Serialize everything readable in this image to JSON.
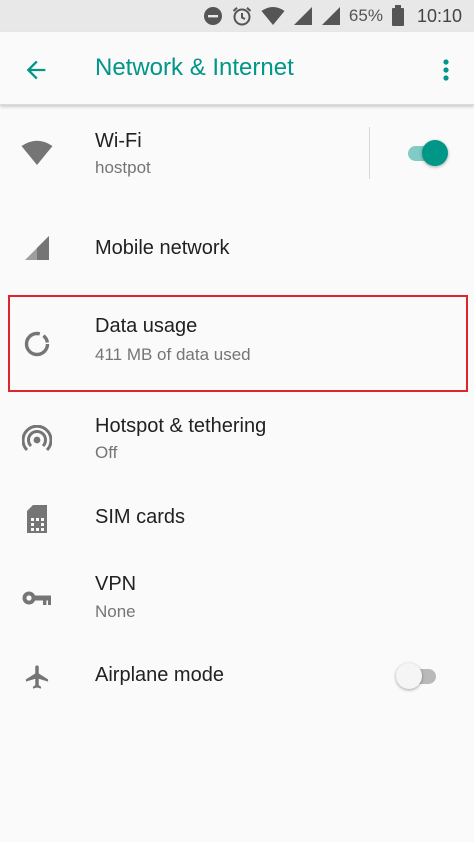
{
  "status_bar": {
    "battery_percent": "65%",
    "time": "10:10",
    "icons": [
      "dnd-icon",
      "alarm-icon",
      "wifi-icon",
      "signal-icon",
      "signal-icon",
      "battery-icon"
    ]
  },
  "app_bar": {
    "title": "Network & Internet",
    "back_icon": "arrow-back-icon",
    "menu_icon": "more-vert-icon"
  },
  "colors": {
    "accent": "#009688",
    "highlight": "#e0242b",
    "toggle_off_track": "#b9b9b9",
    "toggle_off_thumb": "#f5f5f5"
  },
  "items": [
    {
      "id": "wifi",
      "icon": "wifi-icon",
      "title": "Wi-Fi",
      "summary": "hostpot",
      "toggle": true,
      "toggle_on": true
    },
    {
      "id": "mobile",
      "icon": "signal-icon",
      "title": "Mobile network",
      "summary": ""
    },
    {
      "id": "data",
      "icon": "data-usage-icon",
      "title": "Data usage",
      "summary": "411 MB of data used",
      "highlighted": true
    },
    {
      "id": "hotspot",
      "icon": "hotspot-icon",
      "title": "Hotspot & tethering",
      "summary": "Off"
    },
    {
      "id": "sim",
      "icon": "sim-card-icon",
      "title": "SIM cards",
      "summary": ""
    },
    {
      "id": "vpn",
      "icon": "vpn-key-icon",
      "title": "VPN",
      "summary": "None"
    },
    {
      "id": "airplane",
      "icon": "airplane-icon",
      "title": "Airplane mode",
      "summary": "",
      "toggle": true,
      "toggle_on": false
    }
  ]
}
